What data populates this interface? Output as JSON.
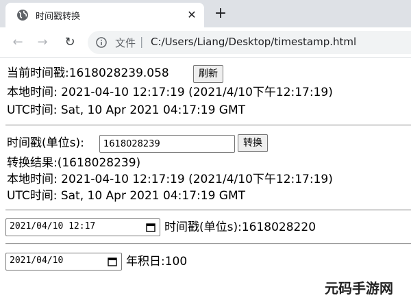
{
  "browser": {
    "tab_title": "时间戳转换",
    "tab_close": "✕",
    "new_tab": "+",
    "back": "←",
    "forward": "→",
    "reload": "↻",
    "site_label": "文件",
    "separator": "|",
    "url": "C:/Users/Liang/Desktop/timestamp.html"
  },
  "current": {
    "label": "当前时间戳:1618028239.058",
    "refresh_button": "刷新",
    "local_time": "本地时间: 2021-04-10 12:17:19 (2021/4/10下午12:17:19)",
    "utc_time": "UTC时间: Sat, 10 Apr 2021 04:17:19 GMT"
  },
  "convert": {
    "label": "时间戳(单位s):",
    "input_value": "1618028239",
    "convert_button": "转换",
    "result": "转换结果:(1618028239)",
    "local_time": "本地时间: 2021-04-10 12:17:19 (2021/4/10下午12:17:19)",
    "utc_time": "UTC时间: Sat, 10 Apr 2021 04:17:19 GMT"
  },
  "datetime_to_ts": {
    "input_value": "2021/04/10  12:17",
    "result_label": "时间戳(单位s):1618028220"
  },
  "day_of_year": {
    "input_value": "2021/04/10",
    "result_label": "年积日:100"
  },
  "watermark": {
    "text": "元码手游网"
  }
}
